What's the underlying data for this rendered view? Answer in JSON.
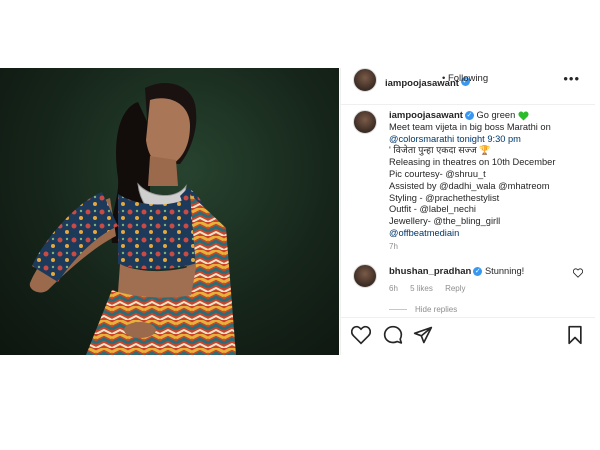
{
  "post": {
    "username": "iampoojasawant",
    "follow_dot": "•",
    "follow_label": "Following",
    "more_label": "•••"
  },
  "caption": {
    "username": "iampoojasawant",
    "lines": [
      "Go green",
      "Meet team vijeta in big boss Marathi on",
      "@colorsmarathi tonight 9:30 pm",
      "' विजेता पुन्हा एकदा सज्ज",
      "Releasing in theatres on 10th December",
      "Pic courtesy- @shruu_t",
      "Assisted by @dadhi_wala @mhatreom",
      "Styling - @prachethestylist",
      "Outfit - @label_nechi",
      "Jewellery- @the_bling_girll",
      "@offbeatmediain"
    ],
    "time": "7h"
  },
  "comment": {
    "username": "bhushan_pradhan",
    "text": "Stunning!",
    "time": "6h",
    "likes": "5 likes",
    "reply": "Reply",
    "hide_replies": "Hide replies"
  },
  "icons": {
    "like": "heart-icon",
    "comment": "comment-icon",
    "share": "share-icon",
    "save": "bookmark-icon",
    "verified": "verified-badge-icon",
    "green_heart": "green-heart-icon"
  },
  "colors": {
    "mention": "#00376b",
    "verified": "#3897f0",
    "green_heart": "#2cbb2c"
  }
}
